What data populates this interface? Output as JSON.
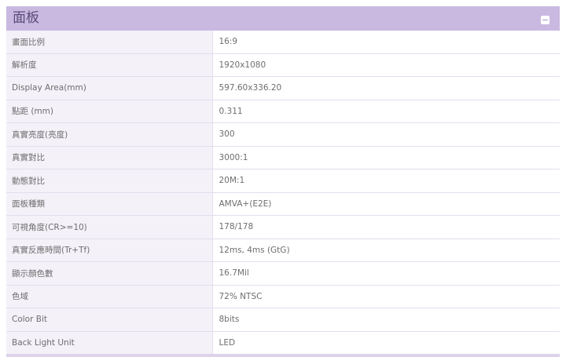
{
  "panel": {
    "title": "面板",
    "collapse_icon": "minus-icon",
    "rows": [
      {
        "label": "畫面比例",
        "value": "16:9"
      },
      {
        "label": "解析度",
        "value": "1920x1080"
      },
      {
        "label": "Display Area(mm)",
        "value": "597.60x336.20"
      },
      {
        "label": "點距 (mm)",
        "value": "0.311"
      },
      {
        "label": "真實亮度(亮度)",
        "value": "300"
      },
      {
        "label": "真實對比",
        "value": "3000:1"
      },
      {
        "label": "動態對比",
        "value": "20M:1"
      },
      {
        "label": "面板種類",
        "value": "AMVA+(E2E)"
      },
      {
        "label": "可視角度(CR>=10)",
        "value": "178/178"
      },
      {
        "label": "真實反應時間(Tr+Tf)",
        "value": "12ms, 4ms (GtG)"
      },
      {
        "label": "顯示顏色數",
        "value": "16.7Mil"
      },
      {
        "label": "色域",
        "value": "72% NTSC"
      },
      {
        "label": "Color Bit",
        "value": "8bits"
      },
      {
        "label": "Back Light Unit",
        "value": "LED"
      }
    ]
  },
  "colors": {
    "header_bg": "#c9b9e0",
    "header_text": "#5b4a7a",
    "label_bg": "#f4f1f8",
    "text": "#6e6e6e"
  }
}
